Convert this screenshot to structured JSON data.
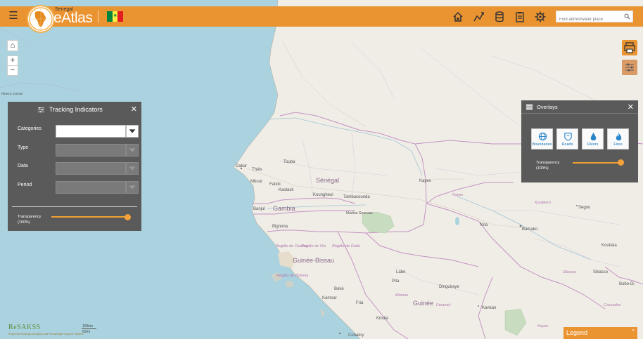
{
  "header": {
    "brand_small": "Senegal",
    "brand": "eAtlas",
    "menu_icon": "hamburger-icon",
    "flag_colors": [
      "#00853f",
      "#fdef42",
      "#e31b23"
    ],
    "nav_icons": [
      "home-icon",
      "trend-icon",
      "database-icon",
      "clipboard-icon",
      "gear-icon"
    ],
    "search_placeholder": "Find admin/water place"
  },
  "map_controls": {
    "home": "⌂",
    "zoom_in": "+",
    "zoom_out": "−"
  },
  "map_labels": {
    "senegal": "Sénégal",
    "gambia": "Gambia",
    "guinea_bissau": "Guinée-Bissau",
    "guinee": "Guinée",
    "dakar": "Dakar",
    "thies": "Thiès",
    "touba": "Touba",
    "mbour": "Mbour",
    "fatick": "Fatick",
    "kaolack": "Kaolack",
    "banjul": "Banjul",
    "bignona": "Bignona",
    "koungheul": "Koungheul",
    "tambacounda": "Tambacounda",
    "kayes": "Kayes",
    "kayes_region": "Kayes",
    "madina_gounass": "Madina Gounass",
    "kita": "Kita",
    "bamako": "Bamako",
    "koulikoro": "Koulikoro",
    "segou": "Ségou",
    "koutiala": "Koutiala",
    "sikasso": "Sikasso",
    "sikasso_region": "Sikasso",
    "bobo": "Bobo-Di",
    "labe": "Labé",
    "pita": "Pita",
    "mamou": "Mamou",
    "boke": "Boké",
    "kamsar": "Kamsar",
    "fria": "Fria",
    "kindia": "Kindia",
    "conakry": "Conakry",
    "faranah": "Faranah",
    "kankan": "Kankan",
    "dinguiraye": "Dinguiraye",
    "regiao_cacheu": "Região de Cacheu",
    "regiao_oio": "Região de Oio",
    "regiao_gabu": "Região de Gabú",
    "regiao_bolama": "Região de Bolama",
    "ribeira_grande": "Ribeira Grande",
    "cascades": "Cascades",
    "kayes_r2": "Kayes"
  },
  "right_buttons": {
    "print_icon": "printer-icon",
    "filter_icon": "sliders-icon"
  },
  "tracking": {
    "title": "Tracking Indicators",
    "title_icon": "sliders-icon",
    "close": "✕",
    "fields": [
      {
        "label": "Categories",
        "value": "",
        "enabled": true
      },
      {
        "label": "Type",
        "value": "",
        "enabled": false
      },
      {
        "label": "Data",
        "value": "",
        "enabled": false
      },
      {
        "label": "Period",
        "value": "",
        "enabled": false
      }
    ],
    "transparency_label": "Transparency",
    "transparency_value": "(100%)",
    "transparency_level": 1.0
  },
  "overlays": {
    "title": "Overlays",
    "title_icon": "layers-icon",
    "close": "✕",
    "buttons": [
      {
        "label": "Boundaries",
        "icon": "globe-icon"
      },
      {
        "label": "Roads",
        "icon": "road-shield-icon"
      },
      {
        "label": "Rivers",
        "icon": "water-drop-icon"
      },
      {
        "label": "Fires",
        "icon": "flame-icon"
      }
    ],
    "transparency_label": "Transparency",
    "transparency_value": "(100%)",
    "transparency_level": 1.0
  },
  "legend": {
    "label": "Legend",
    "arrow": "^"
  },
  "footer": {
    "logo": "ReSAKSS",
    "logo_sub": "Regional Strategic Analysis and Knowledge Support System",
    "scale_km": "100km",
    "scale_mi": "60mi"
  },
  "colors": {
    "accent": "#ea9331",
    "panel": "#5a5a5a",
    "ocean": "#aad3df",
    "land": "#f2efe9",
    "border": "#c9a0c9"
  }
}
